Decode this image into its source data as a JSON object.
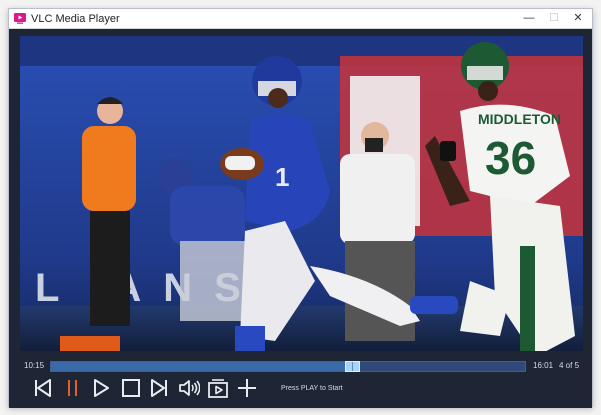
{
  "window": {
    "title": "VLC Media Player",
    "minimize_glyph": "—",
    "maximize_glyph": "☐",
    "close_glyph": "✕"
  },
  "video": {
    "jersey_number": "36",
    "jersey_name": "MIDDLETON",
    "banner_text": "L ANS"
  },
  "playback": {
    "elapsed": "10:15",
    "duration": "16:01",
    "position_fraction": 0.64,
    "playlist_position": "4 of 5",
    "status": "Press PLAY to Start"
  },
  "controls": [
    {
      "name": "previous-button",
      "icon": "skip-previous-icon"
    },
    {
      "name": "pause-button",
      "icon": "pause-icon",
      "color": "#e0602a"
    },
    {
      "name": "play-button",
      "icon": "play-icon"
    },
    {
      "name": "stop-button",
      "icon": "stop-icon"
    },
    {
      "name": "next-button",
      "icon": "skip-next-icon"
    },
    {
      "name": "volume-button",
      "icon": "volume-icon"
    },
    {
      "name": "playlist-button",
      "icon": "playlist-play-icon"
    },
    {
      "name": "add-button",
      "icon": "plus-icon"
    }
  ],
  "colors": {
    "accent": "#e0602a",
    "control_bg": "#1e2636",
    "icon": "#e8ebf0"
  }
}
